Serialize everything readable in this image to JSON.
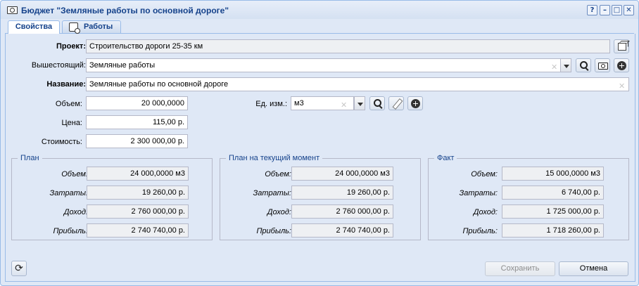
{
  "window": {
    "title": "Бюджет \"Земляные работы по основной дороге\"",
    "buttons": [
      "?",
      "–",
      "□",
      "✕"
    ]
  },
  "tabs": [
    {
      "label": "Свойства",
      "active": true
    },
    {
      "label": "Работы",
      "active": false,
      "icon": "calendar-clock-icon"
    }
  ],
  "form": {
    "project_label": "Проект:",
    "project_value": "Строительство дороги 25-35 км",
    "parent_label": "Вышестоящий:",
    "parent_value": "Земляные работы",
    "name_label": "Название:",
    "name_value": "Земляные работы по основной дороге",
    "volume_label": "Объем:",
    "volume_value": "20 000,0000",
    "price_label": "Цена:",
    "price_value": "115,00 р.",
    "cost_label": "Стоимость:",
    "cost_value": "2 300 000,00 р.",
    "unit_label": "Ед. изм.:",
    "unit_value": "м3",
    "clear_glyph": "✕"
  },
  "groups": [
    {
      "title": "План",
      "rows": [
        {
          "label": "Объем:",
          "value": "24 000,0000 м3"
        },
        {
          "label": "Затраты:",
          "value": "19 260,00 р."
        },
        {
          "label": "Доход:",
          "value": "2 760 000,00 р."
        },
        {
          "label": "Прибыль:",
          "value": "2 740 740,00 р."
        }
      ]
    },
    {
      "title": "План на текущий момент",
      "rows": [
        {
          "label": "Объем:",
          "value": "24 000,0000 м3"
        },
        {
          "label": "Затраты:",
          "value": "19 260,00 р."
        },
        {
          "label": "Доход:",
          "value": "2 760 000,00 р."
        },
        {
          "label": "Прибыль:",
          "value": "2 740 740,00 р."
        }
      ]
    },
    {
      "title": "Факт",
      "rows": [
        {
          "label": "Объем:",
          "value": "15 000,0000 м3"
        },
        {
          "label": "Затраты:",
          "value": "6 740,00 р."
        },
        {
          "label": "Доход:",
          "value": "1 725 000,00 р."
        },
        {
          "label": "Прибыль:",
          "value": "1 718 260,00 р."
        }
      ]
    }
  ],
  "footer": {
    "refresh_glyph": "⟳",
    "save_label": "Сохранить",
    "cancel_label": "Отмена"
  },
  "colors": {
    "title_text": "#15428b",
    "panel_bg": "#dfe8f6",
    "border": "#99bbe8"
  }
}
